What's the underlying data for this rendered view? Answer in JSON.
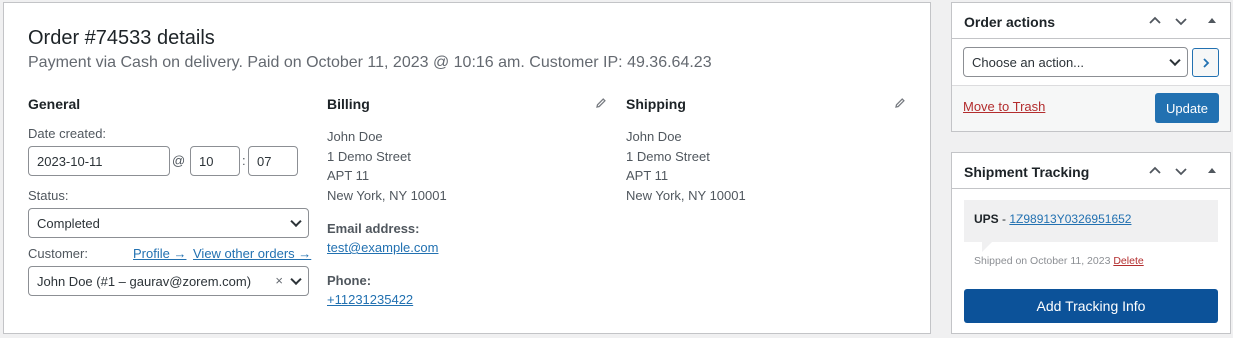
{
  "order": {
    "title": "Order #74533 details",
    "subtitle": "Payment via Cash on delivery. Paid on October 11, 2023 @ 10:16 am. Customer IP: 49.36.64.23"
  },
  "general": {
    "heading": "General",
    "date_label": "Date created:",
    "date_value": "2023-10-11",
    "at": "@",
    "hour": "10",
    "colon": ":",
    "minute": "07",
    "status_label": "Status:",
    "status_value": "Completed",
    "customer_label": "Customer:",
    "profile_link": "Profile →",
    "other_orders_link": "View other orders →",
    "customer_value": "John Doe (#1 – gaurav@zorem.com)",
    "clear_glyph": "×"
  },
  "billing": {
    "heading": "Billing",
    "address": [
      "John Doe",
      "1 Demo Street",
      "APT 11",
      "New York, NY 10001"
    ],
    "email_label": "Email address:",
    "email": "test@example.com",
    "phone_label": "Phone:",
    "phone": "+11231235422"
  },
  "shipping": {
    "heading": "Shipping",
    "address": [
      "John Doe",
      "1 Demo Street",
      "APT 11",
      "New York, NY 10001"
    ]
  },
  "order_actions": {
    "title": "Order actions",
    "select_value": "Choose an action...",
    "trash_link": "Move to Trash",
    "update_button": "Update"
  },
  "shipment_tracking": {
    "title": "Shipment Tracking",
    "carrier": "UPS",
    "dash": " - ",
    "tracking_number": "1Z98913Y0326951652",
    "shipped_text": "Shipped on October 11, 2023",
    "delete_link": "Delete",
    "add_button": "Add Tracking Info"
  },
  "colors": {
    "accent": "#2271b1",
    "danger": "#b32d2e",
    "tracking_button": "#0c5299"
  },
  "icons": [
    "pencil-icon",
    "chevron-up-icon",
    "chevron-down-icon",
    "triangle-up-icon",
    "chevron-right-icon"
  ]
}
